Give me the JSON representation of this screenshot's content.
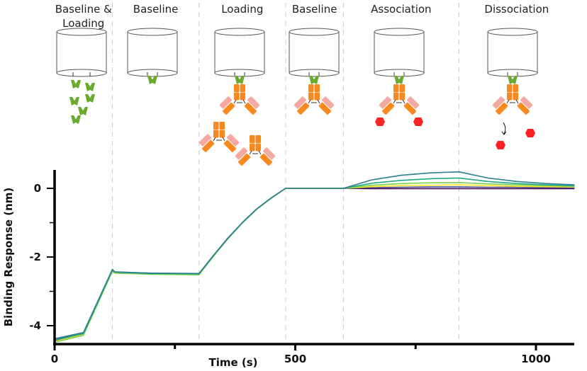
{
  "phases": [
    {
      "label_lines": [
        "Baseline &",
        "Loading"
      ],
      "start": 0,
      "end": 120
    },
    {
      "label_lines": [
        "Baseline"
      ],
      "start": 120,
      "end": 300
    },
    {
      "label_lines": [
        "Loading"
      ],
      "start": 300,
      "end": 480
    },
    {
      "label_lines": [
        "Baseline"
      ],
      "start": 480,
      "end": 600
    },
    {
      "label_lines": [
        "Association"
      ],
      "start": 600,
      "end": 840
    },
    {
      "label_lines": [
        "Dissociation"
      ],
      "start": 840,
      "end": 1080
    }
  ],
  "colors": {
    "ligand": "#6aaa2e",
    "antibody": "#f7891f",
    "light_chain": "#f5a9a0",
    "analyte": "#ff2222",
    "sensor": "#555555",
    "divider": "#cccccc"
  },
  "chart_data": {
    "type": "line",
    "xlabel": "Time (s)",
    "ylabel": "Binding Response (nm)",
    "xlim": [
      0,
      1080
    ],
    "ylim": [
      -4.5,
      0.5
    ],
    "xticks": [
      0,
      500,
      1000
    ],
    "xticks_minor": [
      250,
      750
    ],
    "yticks": [
      0,
      -2,
      -4
    ],
    "yticks_minor": [
      -1,
      -3
    ],
    "grid": false,
    "x": [
      0,
      60,
      120,
      125,
      200,
      300,
      330,
      360,
      390,
      420,
      450,
      480,
      600,
      660,
      720,
      780,
      840,
      900,
      960,
      1020,
      1080
    ],
    "series": [
      {
        "color": "#2c7f8e",
        "values": [
          -4.38,
          -4.2,
          -2.36,
          -2.43,
          -2.47,
          -2.48,
          -1.95,
          -1.45,
          -1.0,
          -0.6,
          -0.28,
          0,
          0,
          0.25,
          0.38,
          0.45,
          0.48,
          0.3,
          0.2,
          0.14,
          0.1
        ]
      },
      {
        "color": "#22a884",
        "values": [
          -4.42,
          -4.23,
          -2.38,
          -2.44,
          -2.48,
          -2.49,
          -1.96,
          -1.46,
          -1.0,
          -0.6,
          -0.28,
          0,
          0,
          0.15,
          0.23,
          0.28,
          0.3,
          0.2,
          0.14,
          0.1,
          0.07
        ]
      },
      {
        "color": "#7ad151",
        "values": [
          -4.48,
          -4.28,
          -2.42,
          -2.47,
          -2.5,
          -2.52,
          -1.98,
          -1.47,
          -1.01,
          -0.61,
          -0.29,
          0,
          0,
          0.09,
          0.14,
          0.16,
          0.17,
          0.13,
          0.1,
          0.08,
          0.06
        ]
      },
      {
        "color": "#fde725",
        "values": [
          -4.46,
          -4.26,
          -2.4,
          -2.46,
          -2.49,
          -2.5,
          -1.97,
          -1.46,
          -1.0,
          -0.6,
          -0.28,
          0,
          0,
          0.05,
          0.08,
          0.09,
          0.1,
          0.08,
          0.06,
          0.05,
          0.04
        ]
      },
      {
        "color": "#414487",
        "values": [
          -4.4,
          -4.21,
          -2.37,
          -2.44,
          -2.47,
          -2.49,
          -1.96,
          -1.45,
          -1.0,
          -0.6,
          -0.28,
          0,
          0,
          0.02,
          0.03,
          0.04,
          0.04,
          0.03,
          0.03,
          0.02,
          0.02
        ]
      },
      {
        "color": "#440154",
        "values": [
          -4.43,
          -4.24,
          -2.39,
          -2.45,
          -2.48,
          -2.5,
          -1.97,
          -1.46,
          -1.0,
          -0.6,
          -0.28,
          0,
          0,
          -0.01,
          -0.01,
          -0.01,
          -0.01,
          -0.01,
          -0.01,
          -0.01,
          -0.01
        ]
      }
    ]
  }
}
